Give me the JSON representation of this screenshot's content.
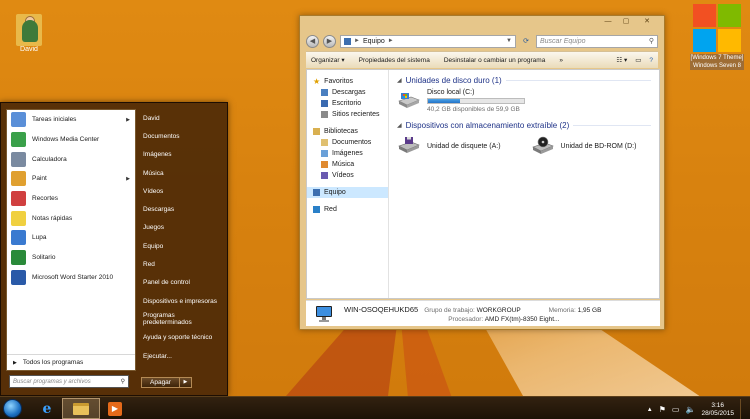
{
  "colors": {
    "wallpaper": "#d8820f",
    "start_menu_bg": "#3c1e06",
    "group_header": "#1e3287",
    "drive_bar": "#2573c7"
  },
  "desktop": {
    "user_folder": {
      "label": "David",
      "icon": "user-folder-icon"
    },
    "windows_logo": {
      "label": "[Windows 7 Theme] Windows Seven 8",
      "icon": "windows-logo-icon",
      "tile_colors": [
        "#f25022",
        "#7fba00",
        "#00a4ef",
        "#ffb900"
      ]
    }
  },
  "explorer": {
    "window_controls": {
      "minimize": "—",
      "maximize": "▢",
      "close": "✕"
    },
    "address": {
      "segment": "Equipo",
      "separator": "►"
    },
    "search_placeholder": "Buscar Equipo",
    "toolbar": {
      "organize": "Organizar",
      "system_properties": "Propiedades del sistema",
      "uninstall": "Desinstalar o cambiar un programa",
      "more": "»"
    },
    "nav": {
      "favorites": "Favoritos",
      "favorites_items": [
        "Descargas",
        "Escritorio",
        "Sitios recientes"
      ],
      "libraries": "Bibliotecas",
      "library_items": [
        "Documentos",
        "Imágenes",
        "Música",
        "Vídeos"
      ],
      "computer": "Equipo",
      "network": "Red"
    },
    "groups": {
      "hard_disks": "Unidades de disco duro (1)",
      "removable": "Dispositivos con almacenamiento extraíble (2)"
    },
    "local_disk": {
      "name": "Disco local (C:)",
      "space": "40,2 GB disponibles de 59,9 GB",
      "used_fraction": 0.33
    },
    "removable_devices": [
      {
        "name": "Unidad de disquete (A:)",
        "icon": "floppy-drive-icon"
      },
      {
        "name": "Unidad de BD-ROM (D:)",
        "icon": "bd-rom-drive-icon"
      }
    ],
    "details": {
      "computer_name": "WIN-OSOQEHUKD65",
      "workgroup_label": "Grupo de trabajo:",
      "workgroup": "WORKGROUP",
      "memory_label": "Memoria:",
      "memory": "1,95 GB",
      "processor_label": "Procesador:",
      "processor": "AMD FX(tm)-8350 Eight..."
    }
  },
  "start_menu": {
    "programs": [
      {
        "label": "Tareas iniciales",
        "arrow": "▶",
        "color": "#5a8fd8"
      },
      {
        "label": "Windows Media Center",
        "arrow": "",
        "color": "#3aa04a"
      },
      {
        "label": "Calculadora",
        "arrow": "",
        "color": "#7a8aa0"
      },
      {
        "label": "Paint",
        "arrow": "▶",
        "color": "#e0a030"
      },
      {
        "label": "Recortes",
        "arrow": "",
        "color": "#d04040"
      },
      {
        "label": "Notas rápidas",
        "arrow": "",
        "color": "#f0d040"
      },
      {
        "label": "Lupa",
        "arrow": "",
        "color": "#3a7ad0"
      },
      {
        "label": "Solitario",
        "arrow": "",
        "color": "#2a8a3a"
      },
      {
        "label": "Microsoft Word Starter 2010",
        "arrow": "",
        "color": "#2a5aa8"
      }
    ],
    "all_programs": "Todos los programas",
    "all_programs_arrow": "▶",
    "search_placeholder": "Buscar programas y archivos",
    "places": [
      "David",
      "Documentos",
      "Imágenes",
      "Música",
      "Vídeos",
      "Descargas",
      "Juegos",
      "Equipo",
      "Red",
      "Panel de control",
      "Dispositivos e impresoras",
      "Programas predeterminados",
      "Ayuda y soporte técnico",
      "Ejecutar..."
    ],
    "shutdown": "Apagar",
    "shutdown_arrow": "▶"
  },
  "taskbar": {
    "pinned": [
      "internet-explorer-icon",
      "file-explorer-icon",
      "media-player-icon"
    ],
    "time": "3:16",
    "date": "28/05/2015"
  }
}
